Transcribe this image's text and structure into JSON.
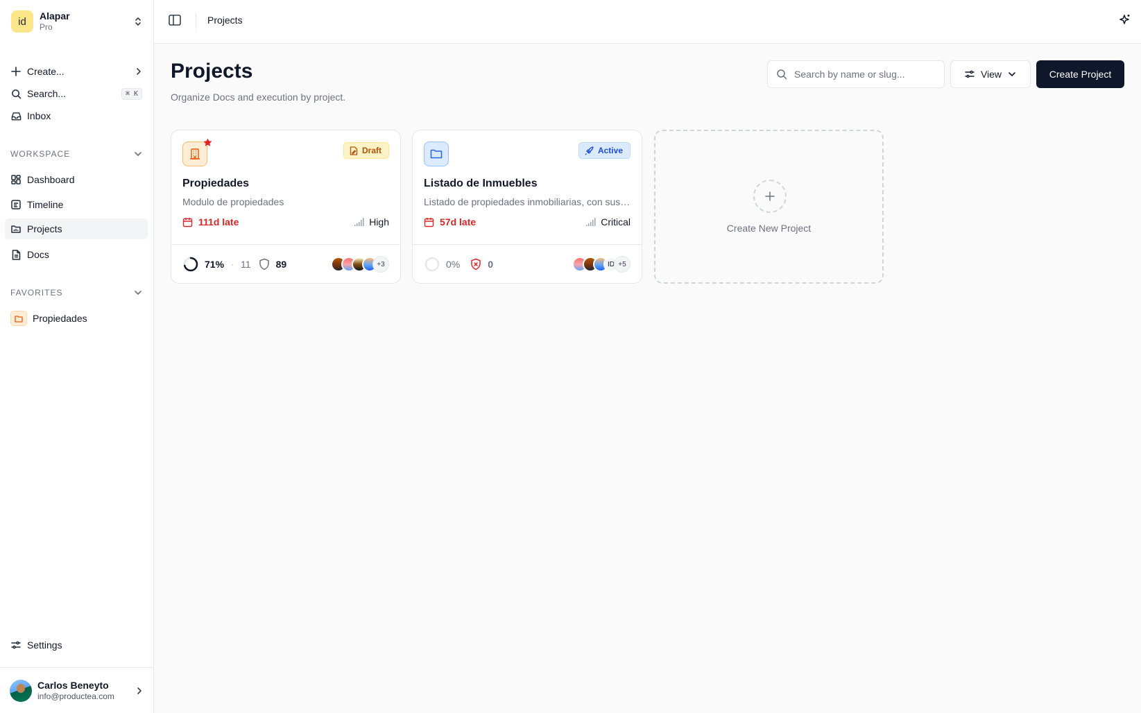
{
  "workspace": {
    "logo_text": "id",
    "name": "Alapar",
    "plan": "Pro"
  },
  "sidebar": {
    "quick": [
      {
        "label": "Create...",
        "icon": "plus-icon"
      },
      {
        "label": "Search...",
        "icon": "search-icon",
        "shortcut": "⌘ K"
      },
      {
        "label": "Inbox",
        "icon": "inbox-icon"
      }
    ],
    "workspace_heading": "WORKSPACE",
    "workspace_items": [
      {
        "label": "Dashboard",
        "icon": "dashboard-icon"
      },
      {
        "label": "Timeline",
        "icon": "timeline-icon"
      },
      {
        "label": "Projects",
        "icon": "projects-icon",
        "active": true
      },
      {
        "label": "Docs",
        "icon": "docs-icon"
      }
    ],
    "favorites_heading": "FAVORITES",
    "favorites": [
      {
        "label": "Propiedades",
        "icon": "folder-icon"
      }
    ],
    "settings_label": "Settings"
  },
  "user": {
    "name": "Carlos Beneyto",
    "email": "info@productea.com"
  },
  "topbar": {
    "breadcrumb": "Projects"
  },
  "page": {
    "title": "Projects",
    "subtitle": "Organize Docs and execution by project.",
    "search_placeholder": "Search by name or slug...",
    "view_label": "View",
    "create_label": "Create Project"
  },
  "projects": [
    {
      "name": "Propiedades",
      "description": "Modulo de propiedades",
      "status": "Draft",
      "due": "111d late",
      "priority": "High",
      "progress": 71,
      "progress_label": "71%",
      "issue_count": "11",
      "risk_count": "89",
      "more_members": "+3",
      "favorite": true
    },
    {
      "name": "Listado de Inmuebles",
      "description": "Listado de propiedades inmobiliarias, con sus características",
      "status": "Active",
      "due": "57d late",
      "priority": "Critical",
      "progress": 0,
      "progress_label": "0%",
      "risk_count": "0",
      "member_initials": "ID",
      "more_members": "+5",
      "favorite": false
    }
  ],
  "new_project_label": "Create New Project",
  "colors": {
    "primary": "#0f172a",
    "danger": "#dc2626",
    "draft": "#b45309",
    "active": "#1d4ed8"
  }
}
